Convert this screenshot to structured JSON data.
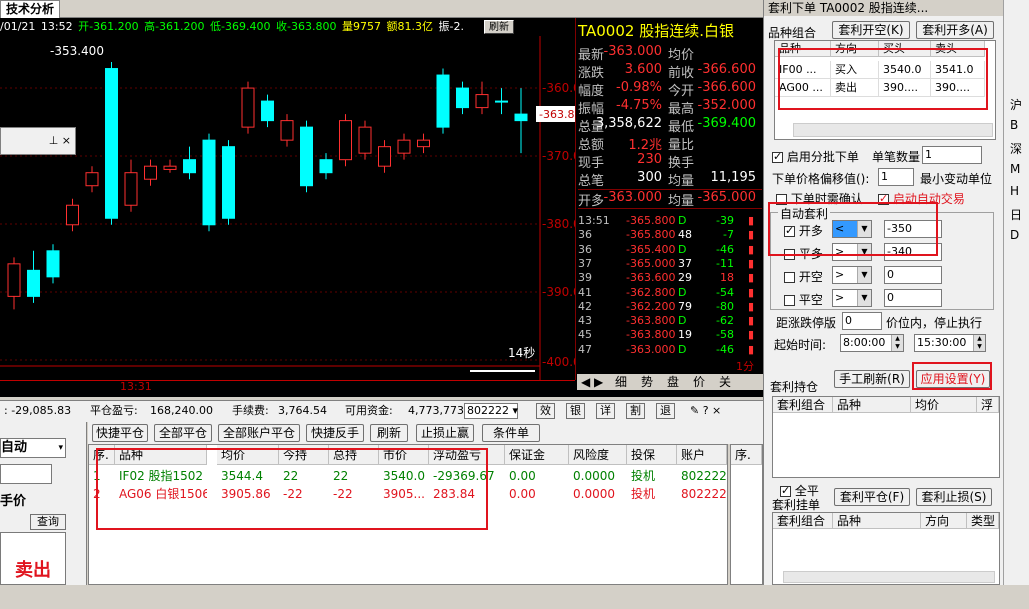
{
  "tab": {
    "title": "技术分析"
  },
  "info": {
    "date": "/01/21",
    "time": "13:52",
    "open": "开-361.200",
    "high": "高-361.200",
    "low": "低-369.400",
    "close": "收-363.800",
    "vol": "量9757",
    "amt": "额81.3亿",
    "amp": "振-2.",
    "refresh": "刷新"
  },
  "chart": {
    "price_labels": [
      "-353.400",
      "-360.0",
      "-363.8",
      "-370.0",
      "-380.0",
      "-390.0",
      "-400.0"
    ],
    "time_label": "13:31",
    "sec_label": "14秒",
    "float_icons": "⊥ ×"
  },
  "quote": {
    "title": "TA0002 股指连续.白银",
    "rows": [
      {
        "l": "最新",
        "v": "-363.000",
        "l2": "均价",
        "v2": ""
      },
      {
        "l": "涨跌",
        "v": "3.600",
        "l2": "前收",
        "v2": "-366.600"
      },
      {
        "l": "幅度",
        "v": "-0.98%",
        "l2": "今开",
        "v2": "-366.600"
      },
      {
        "l": "振幅",
        "v": "-4.75%",
        "l2": "最高",
        "v2": "-352.000"
      },
      {
        "l": "总量",
        "v": "3,358,622",
        "l2": "最低",
        "v2": "-369.400"
      },
      {
        "l": "总额",
        "v": "1.2兆",
        "l2": "量比",
        "v2": ""
      },
      {
        "l": "现手",
        "v": "230",
        "l2": "换手",
        "v2": ""
      },
      {
        "l": "总笔",
        "v": "300",
        "l2": "均量",
        "v2": "11,195"
      }
    ],
    "open_row": {
      "l": "开多",
      "v": "-363.000",
      "l2": "均量",
      "v2": "-365.000"
    },
    "ticks": [
      {
        "t": "13:51",
        "p": "-365.800",
        "q": "D",
        "n": "-39"
      },
      {
        "t": "36",
        "p": "-365.800",
        "q": "48",
        "n": "-7"
      },
      {
        "t": "36",
        "p": "-365.400",
        "q": "D",
        "n": "-46"
      },
      {
        "t": "37",
        "p": "-365.000",
        "q": "37",
        "n": "-11"
      },
      {
        "t": "39",
        "p": "-363.600",
        "q": "29",
        "n": "18"
      },
      {
        "t": "41",
        "p": "-362.800",
        "q": "D",
        "n": "-54"
      },
      {
        "t": "42",
        "p": "-362.200",
        "q": "79",
        "n": "-80"
      },
      {
        "t": "43",
        "p": "-363.800",
        "q": "D",
        "n": "-62"
      },
      {
        "t": "45",
        "p": "-363.800",
        "q": "19",
        "n": "-58"
      },
      {
        "t": "47",
        "p": "-363.000",
        "q": "D",
        "n": "-46"
      }
    ],
    "bottom_tabs": [
      "细",
      "势",
      "盘",
      "价",
      "关"
    ],
    "minute": "1分"
  },
  "account": {
    "pl": "-29,085.83",
    "floating_label": "平仓盈亏:",
    "floating": "168,240.00",
    "fee_label": "手续费:",
    "fee": "3,764.54",
    "avail_label": "可用资金:",
    "avail": "4,773,773",
    "acct_id": "802222",
    "icons": [
      "效",
      "银",
      "详",
      "割",
      "退"
    ]
  },
  "left": {
    "mode": "自动",
    "price_label": "手价",
    "query": "查询",
    "sell": "卖出"
  },
  "buttons": [
    "快捷平仓",
    "全部平仓",
    "全部账户平仓",
    "快捷反手",
    "刷新",
    "止损止赢",
    "条件单"
  ],
  "grid": {
    "headers": [
      "序.",
      "品种",
      "均价",
      "今持",
      "总持",
      "市价",
      "浮动盈亏",
      "保证金",
      "风险度",
      "投保",
      "账户"
    ],
    "rows": [
      [
        "1",
        "IF02 股指1502",
        "3544.4",
        "22",
        "22",
        "3540.0",
        "-29369.67",
        "0.00",
        "0.0000",
        "投机",
        "802222"
      ],
      [
        "2",
        "AG06 白银1506",
        "3905.86",
        "-22",
        "-22",
        "3905...",
        "283.84",
        "0.00",
        "0.0000",
        "投机",
        "802222"
      ]
    ],
    "side_header": "序."
  },
  "rp": {
    "title": "套利下单  TA0002 股指连续...",
    "combo_label": "品种组合",
    "btn_open": "套利开空(K)",
    "btn_open2": "套利开多(A)",
    "combo_headers": [
      "品种",
      "方向",
      "买头",
      "卖头"
    ],
    "combo_rows": [
      [
        "IF00 ...",
        "买入",
        "3540.0",
        "3541.0"
      ],
      [
        "AG00 ...",
        "卖出",
        "390....",
        "390...."
      ]
    ],
    "batch": "启用分批下单",
    "lot_label": "单笔数量",
    "lot": "1",
    "offset_label": "下单价格偏移值():",
    "offset": "1",
    "offset_unit": "最小变动单位",
    "confirm": "下单时需确认",
    "auto": "启动自动交易",
    "auto_arb": "自动套利",
    "arb_rows": [
      {
        "label": "开多",
        "op": "<",
        "val": "-350",
        "on": true
      },
      {
        "label": "平多",
        "op": ">",
        "val": "-340",
        "on": false
      },
      {
        "label": "开空",
        "op": ">",
        "val": "0",
        "on": false
      },
      {
        "label": "平空",
        "op": ">",
        "val": "0",
        "on": false
      }
    ],
    "stop_label": "距涨跌停版",
    "stop": "0",
    "stop_unit": "价位内，停止执行",
    "start_label": "起始时间:",
    "start": "8:00:00",
    "end": "15:30:00",
    "hold_label": "套利持仓",
    "manual": "手工刷新(R)",
    "apply": "应用设置(Y)",
    "hold_headers": [
      "套利组合",
      "品种",
      "均价",
      "浮"
    ],
    "all_flat": "全平",
    "pending_label": "套利挂单",
    "close_btn": "套利平仓(F)",
    "stop_btn": "套利止损(S)",
    "pend_headers": [
      "套利组合",
      "品种",
      "方向",
      "类型"
    ]
  },
  "farright": [
    "沪",
    "B",
    "深",
    "M",
    "H",
    "日",
    "D"
  ]
}
